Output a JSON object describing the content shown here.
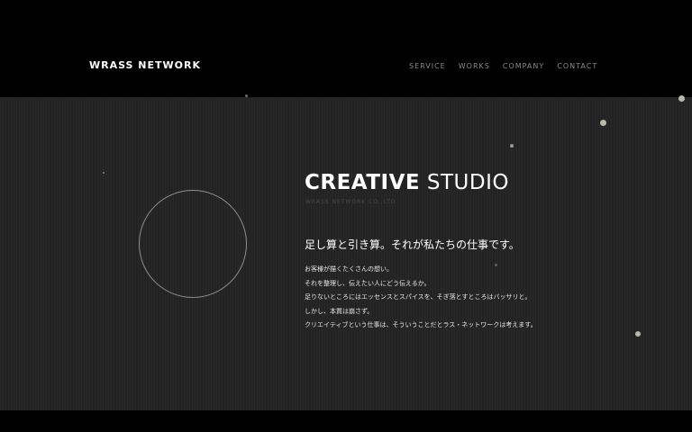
{
  "header": {
    "logo": "WRASS NETWORK",
    "nav": [
      "SERVICE",
      "WORKS",
      "COMPANY",
      "CONTACT"
    ]
  },
  "hero": {
    "title_bold": "CREATIVE",
    "title_light": "STUDIO",
    "subtitle": "WRASS NETWORK CO.,LTD",
    "headline": "足し算と引き算。それが私たちの仕事です。",
    "body": [
      "お客様が描くたくさんの想い。",
      "それを整理し、伝えたい人にどう伝えるか。",
      "足りないところにはエッセンスとスパイスを、そぎ落とすところはバッサリと。",
      "しかし、本質は崩さず。",
      "クリエイティブという仕事は、そういうことだとラス・ネットワークは考えます。"
    ]
  },
  "colors": {
    "background": "#232323",
    "bar": "#000000",
    "text": "#ffffff",
    "nav": "#8a8a8a",
    "dot": "#b9b7a6"
  }
}
